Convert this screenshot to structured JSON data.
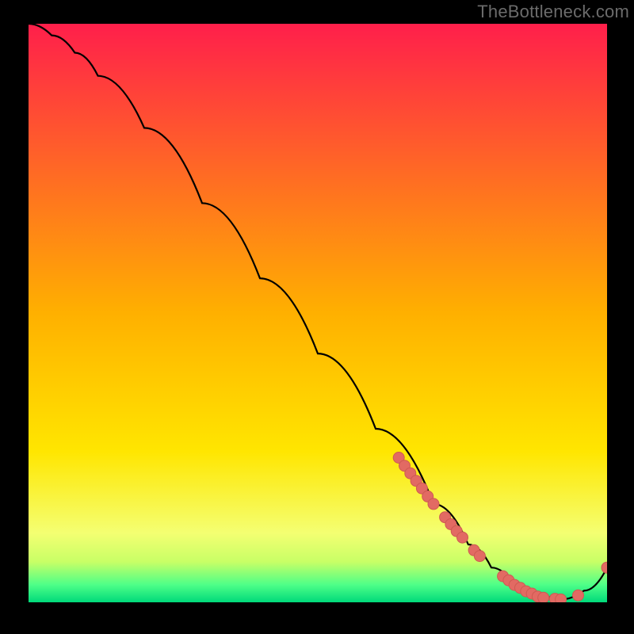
{
  "watermark": "TheBottleneck.com",
  "colors": {
    "bg": "#000000",
    "watermark": "#6b6b6b",
    "gradient_top": "#ff1f4b",
    "gradient_mid": "#ffd400",
    "gradient_low": "#f7ff66",
    "gradient_green_top": "#5bff7a",
    "gradient_green_bottom": "#00d97a",
    "curve": "#000000",
    "marker_fill": "#e26a63",
    "marker_stroke": "#ce5a52"
  },
  "chart_data": {
    "type": "line",
    "title": "",
    "xlabel": "",
    "ylabel": "",
    "xlim": [
      0,
      100
    ],
    "ylim": [
      0,
      100
    ],
    "series": [
      {
        "name": "bottleneck-curve",
        "x": [
          0,
          4,
          8,
          12,
          20,
          30,
          40,
          50,
          60,
          70,
          76,
          80,
          84,
          88,
          92,
          96,
          100
        ],
        "y": [
          100,
          98,
          95,
          91,
          82,
          69,
          56,
          43,
          30,
          17,
          10,
          6,
          3,
          1,
          0.5,
          2,
          6
        ]
      }
    ],
    "markers": {
      "name": "highlighted-points",
      "x": [
        64,
        65,
        66,
        67,
        68,
        69,
        70,
        72,
        73,
        74,
        75,
        77,
        78,
        82,
        83,
        84,
        85,
        86,
        87,
        88,
        89,
        91,
        92,
        95,
        100
      ],
      "y": [
        25,
        23.6,
        22.3,
        21,
        19.7,
        18.3,
        17,
        14.7,
        13.5,
        12.3,
        11.2,
        9,
        8,
        4.5,
        3.8,
        3,
        2.5,
        1.9,
        1.5,
        1,
        0.8,
        0.6,
        0.5,
        1.2,
        6
      ]
    }
  }
}
